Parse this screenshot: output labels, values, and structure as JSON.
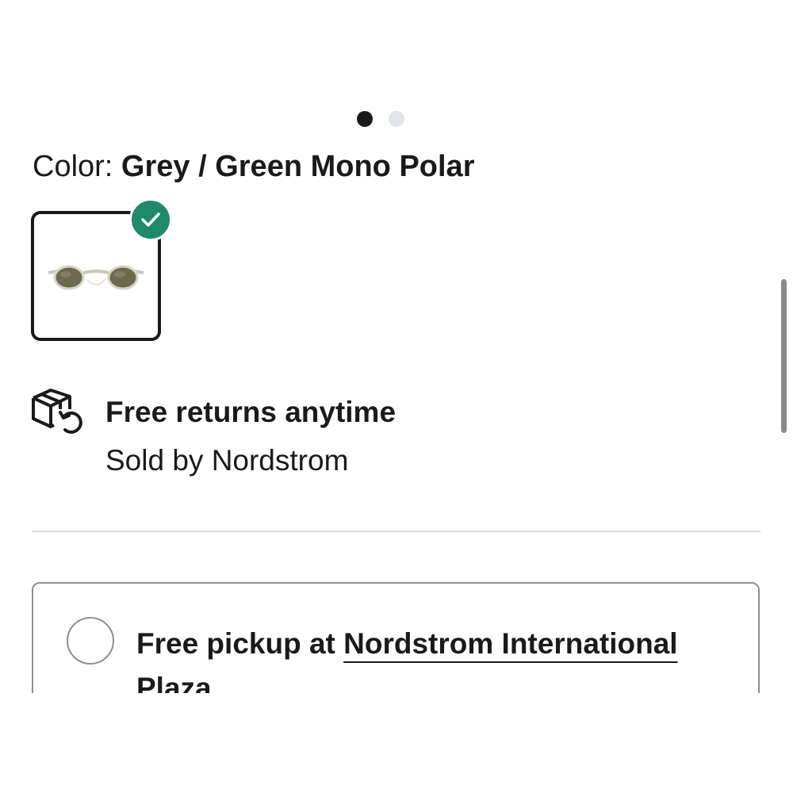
{
  "carousel": {
    "dots": [
      {
        "active": true
      },
      {
        "active": false
      }
    ]
  },
  "color": {
    "label": "Color: ",
    "value": "Grey / Green Mono Polar"
  },
  "swatch": {
    "selected": true,
    "icon": "checkmark-icon",
    "accent_color": "#1e8a6a"
  },
  "returns": {
    "icon": "box-return-icon",
    "title": "Free returns anytime",
    "subtitle": "Sold by Nordstrom"
  },
  "pickup": {
    "prefix": "Free pickup at ",
    "store": "Nordstrom International Plaza",
    "selected": false
  }
}
